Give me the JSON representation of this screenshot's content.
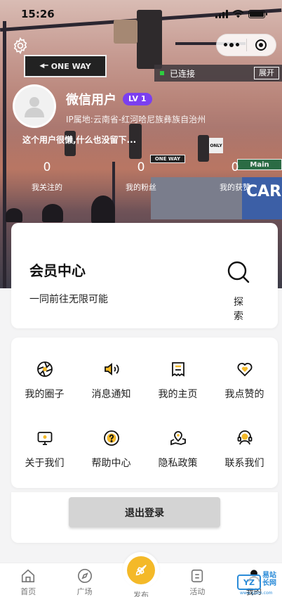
{
  "status_bar": {
    "time": "15:26"
  },
  "connection": {
    "status": "已连接",
    "expand_label": "展开"
  },
  "profile": {
    "nickname": "微信用户",
    "level": "LV 1",
    "ip_location": "IP属地:云南省-红河哈尼族彝族自治州",
    "bio": "这个用户很懒,什么也没留下..."
  },
  "stats": [
    {
      "value": "0",
      "label": "我关注的"
    },
    {
      "value": "0",
      "label": "我的粉丝"
    },
    {
      "value": "0",
      "label": "我的获赞"
    }
  ],
  "vip_card": {
    "title": "会员中心",
    "subtitle": "一同前往无限可能",
    "explore_label": "探 索"
  },
  "menu": {
    "items": [
      {
        "label": "我的圈子",
        "icon": "aperture-icon"
      },
      {
        "label": "消息通知",
        "icon": "speaker-icon"
      },
      {
        "label": "我的主页",
        "icon": "receipt-icon"
      },
      {
        "label": "我点赞的",
        "icon": "heart-icon"
      },
      {
        "label": "关于我们",
        "icon": "monitor-icon"
      },
      {
        "label": "帮助中心",
        "icon": "help-icon"
      },
      {
        "label": "隐私政策",
        "icon": "map-pin-icon"
      },
      {
        "label": "联系我们",
        "icon": "headset-icon"
      }
    ]
  },
  "logout_label": "退出登录",
  "tabbar": {
    "items": [
      {
        "label": "首页",
        "icon": "home-icon"
      },
      {
        "label": "广场",
        "icon": "compass-icon"
      },
      {
        "label": "发布",
        "icon": "rocket-icon"
      },
      {
        "label": "活动",
        "icon": "activity-icon"
      },
      {
        "label": "我的",
        "icon": "user-icon"
      }
    ]
  },
  "watermark": {
    "logo": "YZ",
    "name": "易站\n长网",
    "url": "www.yzzm.com"
  },
  "hero_signs": {
    "one_way": "ONE WAY",
    "one_way_small": "ONE WAY",
    "main": "Main",
    "only": "ONLY",
    "building": "CAR"
  },
  "colors": {
    "accent_yellow": "#f4b928",
    "level_purple": "#7b3ff0",
    "connected_green": "#2ecc40"
  }
}
